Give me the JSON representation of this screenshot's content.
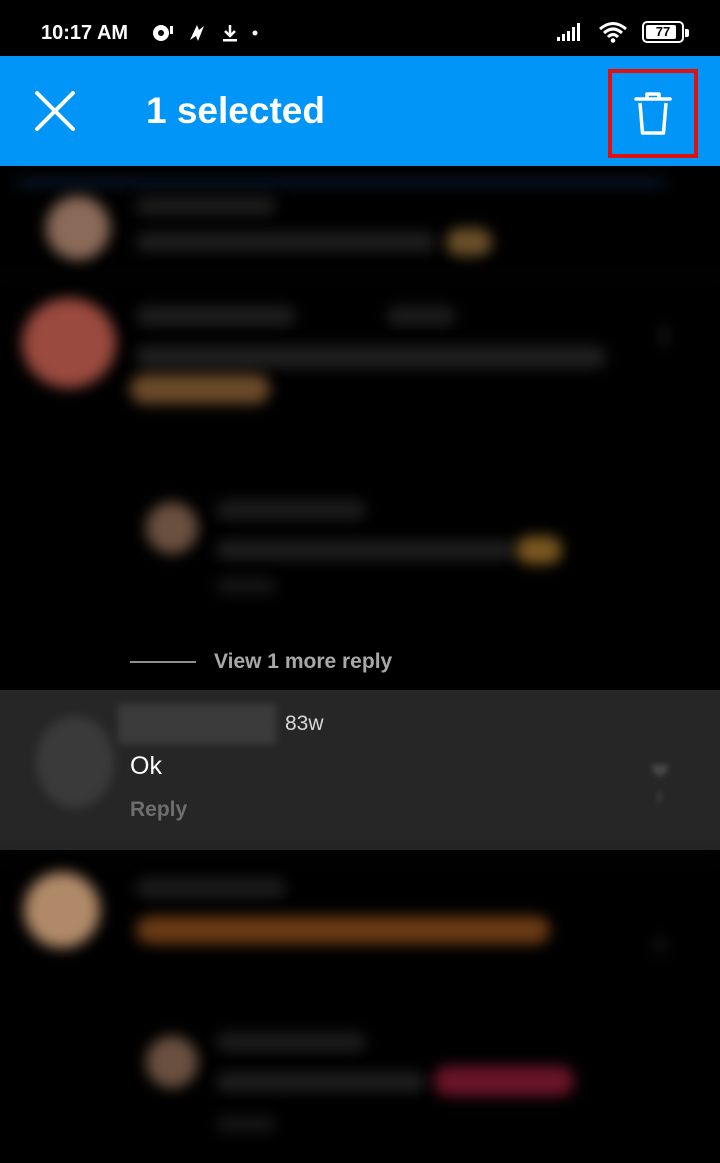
{
  "status_bar": {
    "time": "10:17 AM",
    "battery": "77"
  },
  "action_bar": {
    "title": "1 selected",
    "close_icon": "close-icon",
    "delete_icon": "trash-icon"
  },
  "comments": {
    "view_more_replies": "View 1 more reply",
    "selected": {
      "time": "83w",
      "text": "Ok",
      "reply_label": "Reply"
    }
  },
  "colors": {
    "action_bar": "#0095f6",
    "highlight_box": "#e01010",
    "selected_row": "#262626"
  }
}
